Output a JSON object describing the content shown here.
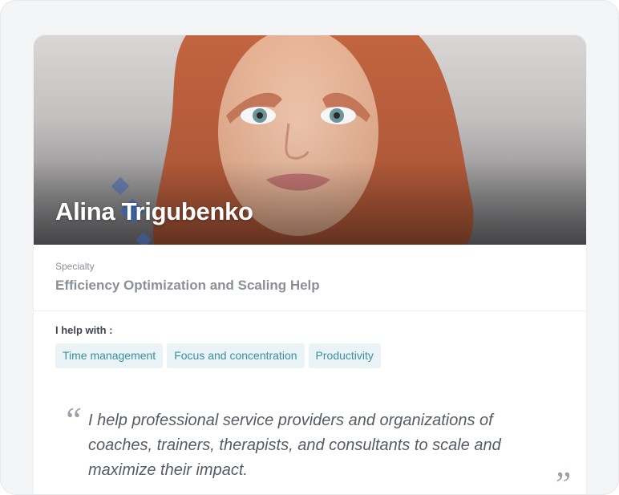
{
  "profile": {
    "name": "Alina Trigubenko",
    "specialty_label": "Specialty",
    "specialty_value": "Efficiency Optimization and Scaling Help",
    "help_title": "I help with :",
    "tags": [
      "Time management",
      "Focus and concentration",
      "Productivity"
    ],
    "quote_open": "“",
    "quote": " I help professional service providers and organizations of coaches, trainers, therapists, and consultants to scale and maximize their impact.",
    "quote_close": "”"
  },
  "colors": {
    "tag_bg": "#eaf3f5",
    "tag_text": "#3c8fa0",
    "accent_diamond": "#3a5fa8"
  }
}
